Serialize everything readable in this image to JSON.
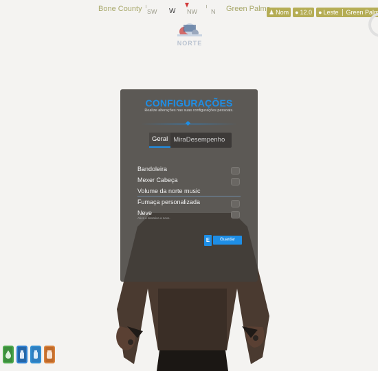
{
  "hud": {
    "location_left": "Bone County",
    "location_right": "Green Palms",
    "compass": [
      "SW",
      "W",
      "NW",
      "N"
    ],
    "badges": {
      "name": "Nom",
      "number": "12.0",
      "direction": "Leste",
      "zone": "Green Palms"
    }
  },
  "panel": {
    "title": "CONFIGURAÇÕES",
    "subtitle": "Realize alterações nas suas configurações pessoais.",
    "tabs": [
      {
        "label": "Geral",
        "active": true
      },
      {
        "label": "Mira",
        "active": false
      },
      {
        "label": "Desempenho",
        "active": false
      }
    ],
    "options": [
      {
        "label": "Bandoleira",
        "type": "toggle",
        "enabled": false
      },
      {
        "label": "Mexer Cabeça",
        "type": "toggle",
        "enabled": false
      },
      {
        "label": "Volume da norte music",
        "type": "slider"
      },
      {
        "label": "Fumaça personalizada",
        "type": "toggle",
        "enabled": false
      },
      {
        "label": "Neve",
        "description": "Ativa e desativa a neve.",
        "type": "toggle",
        "enabled": false
      }
    ],
    "key_hint": "E",
    "save_label": "Guardar"
  },
  "status_icons": [
    {
      "name": "health-icon",
      "color": "#4aa64a"
    },
    {
      "name": "armor-icon",
      "color": "#2d7fd1"
    },
    {
      "name": "water-icon",
      "color": "#2f8dd1"
    },
    {
      "name": "food-icon",
      "color": "#d8813b"
    }
  ],
  "colors": {
    "accent": "#1e8ee6",
    "badge": "#b5ad55",
    "panel_bg": "#423f3b"
  }
}
